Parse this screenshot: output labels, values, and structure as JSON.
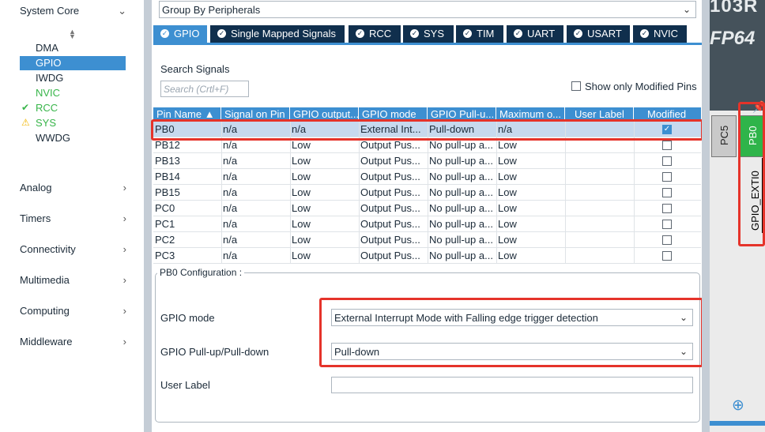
{
  "left_panel": {
    "system_core": {
      "label": "System Core",
      "chevron": "chevron-down-icon"
    },
    "items": [
      {
        "label": "DMA",
        "status": ""
      },
      {
        "label": "GPIO",
        "status": "selected"
      },
      {
        "label": "IWDG",
        "status": ""
      },
      {
        "label": "NVIC",
        "status": "green"
      },
      {
        "label": "RCC",
        "status": "ok",
        "icon": "✔"
      },
      {
        "label": "SYS",
        "status": "warning",
        "icon": "⚠"
      },
      {
        "label": "WWDG",
        "status": ""
      }
    ],
    "categories": [
      {
        "label": "Analog"
      },
      {
        "label": "Timers"
      },
      {
        "label": "Connectivity"
      },
      {
        "label": "Multimedia"
      },
      {
        "label": "Computing"
      },
      {
        "label": "Middleware"
      }
    ]
  },
  "mode_panel": {
    "group_by": "Group By Peripherals",
    "tabs": [
      {
        "label": "GPIO",
        "active": true
      },
      {
        "label": "Single Mapped Signals"
      },
      {
        "label": "RCC"
      },
      {
        "label": "SYS"
      },
      {
        "label": "TIM"
      },
      {
        "label": "UART"
      },
      {
        "label": "USART"
      },
      {
        "label": "NVIC"
      }
    ],
    "search_label": "Search Signals",
    "search_placeholder": "Search (Crtl+F)",
    "show_modified_label": "Show only Modified Pins",
    "table": {
      "headers": [
        "Pin Name ▲",
        "Signal on Pin",
        "GPIO output...",
        "GPIO mode",
        "GPIO Pull-u...",
        "Maximum o...",
        "User Label",
        "Modified"
      ],
      "rows": [
        {
          "pin": "PB0",
          "signal": "n/a",
          "output": "n/a",
          "mode": "External Int...",
          "pull": "Pull-down",
          "max": "n/a",
          "label": "",
          "modified": true
        },
        {
          "pin": "PB12",
          "signal": "n/a",
          "output": "Low",
          "mode": "Output Pus...",
          "pull": "No pull-up a...",
          "max": "Low",
          "label": "",
          "modified": false
        },
        {
          "pin": "PB13",
          "signal": "n/a",
          "output": "Low",
          "mode": "Output Pus...",
          "pull": "No pull-up a...",
          "max": "Low",
          "label": "",
          "modified": false
        },
        {
          "pin": "PB14",
          "signal": "n/a",
          "output": "Low",
          "mode": "Output Pus...",
          "pull": "No pull-up a...",
          "max": "Low",
          "label": "",
          "modified": false
        },
        {
          "pin": "PB15",
          "signal": "n/a",
          "output": "Low",
          "mode": "Output Pus...",
          "pull": "No pull-up a...",
          "max": "Low",
          "label": "",
          "modified": false
        },
        {
          "pin": "PC0",
          "signal": "n/a",
          "output": "Low",
          "mode": "Output Pus...",
          "pull": "No pull-up a...",
          "max": "Low",
          "label": "",
          "modified": false
        },
        {
          "pin": "PC1",
          "signal": "n/a",
          "output": "Low",
          "mode": "Output Pus...",
          "pull": "No pull-up a...",
          "max": "Low",
          "label": "",
          "modified": false
        },
        {
          "pin": "PC2",
          "signal": "n/a",
          "output": "Low",
          "mode": "Output Pus...",
          "pull": "No pull-up a...",
          "max": "Low",
          "label": "",
          "modified": false
        },
        {
          "pin": "PC3",
          "signal": "n/a",
          "output": "Low",
          "mode": "Output Pus...",
          "pull": "No pull-up a...",
          "max": "Low",
          "label": "",
          "modified": false
        }
      ]
    },
    "config": {
      "title": "PB0 Configuration :",
      "gpio_mode_label": "GPIO mode",
      "gpio_mode_value": "External Interrupt Mode with Falling edge trigger detection",
      "pull_label": "GPIO Pull-up/Pull-down",
      "pull_value": "Pull-down",
      "user_label_label": "User Label",
      "user_label_value": ""
    }
  },
  "chip_view": {
    "chip_text_1": "103R",
    "chip_text_2": "FP64",
    "pin_pc5": "PC5",
    "pin_pb0": "PB0",
    "pin_signal": "GPIO_EXTI0"
  },
  "colors": {
    "accent": "#3d8fd1",
    "tab_dark": "#102f4d",
    "pin_green": "#2fb44a",
    "highlight_red": "#e5332a"
  }
}
